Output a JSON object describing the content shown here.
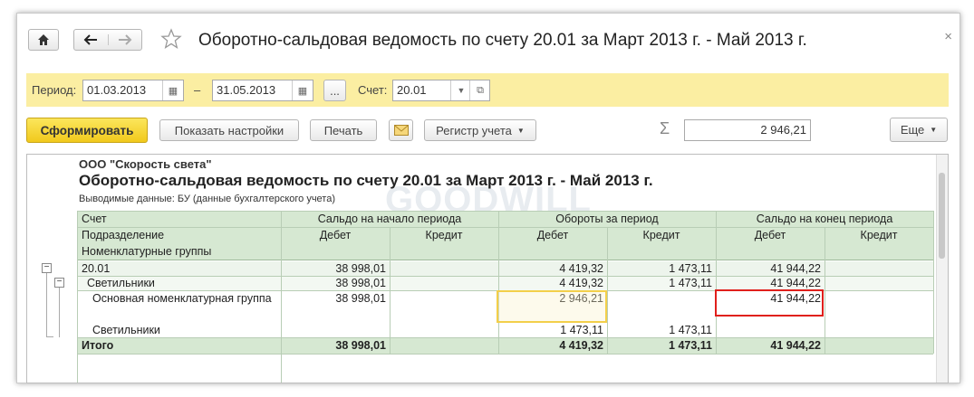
{
  "toolbar": {
    "home_icon": "home-icon",
    "back_icon": "arrow-left-icon",
    "forward_icon": "arrow-right-icon",
    "star_icon": "star-icon",
    "close_icon": "close-icon"
  },
  "window_title": "Оборотно-сальдовая ведомость по счету 20.01 за Март 2013 г. - Май 2013 г.",
  "filters": {
    "period_label": "Период:",
    "date_from": "01.03.2013",
    "dash": "–",
    "date_to": "31.05.2013",
    "ellipsis": "...",
    "account_label": "Счет:",
    "account_value": "20.01"
  },
  "actions": {
    "generate": "Сформировать",
    "settings": "Показать настройки",
    "print": "Печать",
    "register": "Регистр учета",
    "sigma": "Σ",
    "sum_value": "2 946,21",
    "more": "Еще"
  },
  "report": {
    "org": "ООО \"Скорость света\"",
    "title": "Оборотно-сальдовая ведомость по счету 20.01 за Март 2013 г. - Май 2013 г.",
    "output": "Выводимые данные:  БУ (данные бухгалтерского учета)",
    "watermark": "GOODWILL",
    "header": {
      "account": "Счет",
      "subdivision": "Подразделение",
      "groups": "Номенклатурные группы",
      "opening": "Сальдо на начало периода",
      "turnover": "Обороты за период",
      "closing": "Сальдо на конец периода",
      "debit": "Дебет",
      "credit": "Кредит"
    },
    "rows": [
      {
        "name": "20.01",
        "od": "38 998,01",
        "oc": "",
        "td": "4 419,32",
        "tc": "1 473,11",
        "cd": "41 944,22",
        "cc": ""
      },
      {
        "name": "Светильники",
        "od": "38 998,01",
        "oc": "",
        "td": "4 419,32",
        "tc": "1 473,11",
        "cd": "41 944,22",
        "cc": ""
      },
      {
        "name": "Основная номенклатурная группа",
        "od": "38 998,01",
        "oc": "",
        "td": "2 946,21",
        "tc": "",
        "cd": "41 944,22",
        "cc": ""
      },
      {
        "name": "Светильники",
        "od": "",
        "oc": "",
        "td": "1 473,11",
        "tc": "1 473,11",
        "cd": "",
        "cc": ""
      }
    ],
    "total": {
      "name": "Итого",
      "od": "38 998,01",
      "oc": "",
      "td": "4 419,32",
      "tc": "1 473,11",
      "cd": "41 944,22",
      "cc": ""
    },
    "tree_minus": "−"
  }
}
